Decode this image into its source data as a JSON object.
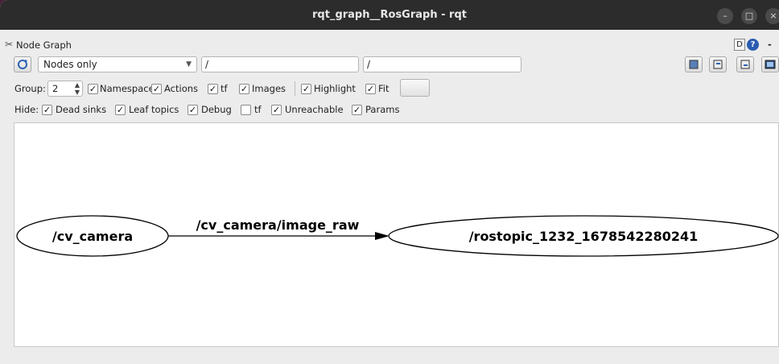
{
  "window": {
    "title": "rqt_graph__RosGraph - rqt",
    "min_label": "–",
    "max_label": "□",
    "close_label": "×"
  },
  "plugin": {
    "title": "Node Graph",
    "d_label": "D",
    "help_icon": "?",
    "dash": "-"
  },
  "row1": {
    "mode_select": "Nodes only",
    "filter_nodes": "/",
    "filter_topics": "/"
  },
  "row2": {
    "group_label": "Group:",
    "group_value": "2",
    "namespaces": "Namespaces",
    "actions": "Actions",
    "tf": "tf",
    "images": "Images",
    "highlight": "Highlight",
    "fit": "Fit",
    "checks": {
      "namespaces": true,
      "actions": true,
      "tf": true,
      "images": true,
      "highlight": true,
      "fit": true
    }
  },
  "row3": {
    "hide_label": "Hide:",
    "dead_sinks": "Dead sinks",
    "leaf_topics": "Leaf topics",
    "debug": "Debug",
    "tf": "tf",
    "unreachable": "Unreachable",
    "params": "Params",
    "checks": {
      "dead_sinks": true,
      "leaf_topics": true,
      "debug": true,
      "tf": false,
      "unreachable": true,
      "params": true
    }
  },
  "graph": {
    "source_node": "/cv_camera",
    "edge_topic": "/cv_camera/image_raw",
    "target_node": "/rostopic_1232_1678542280241"
  },
  "check_glyph": "✓"
}
